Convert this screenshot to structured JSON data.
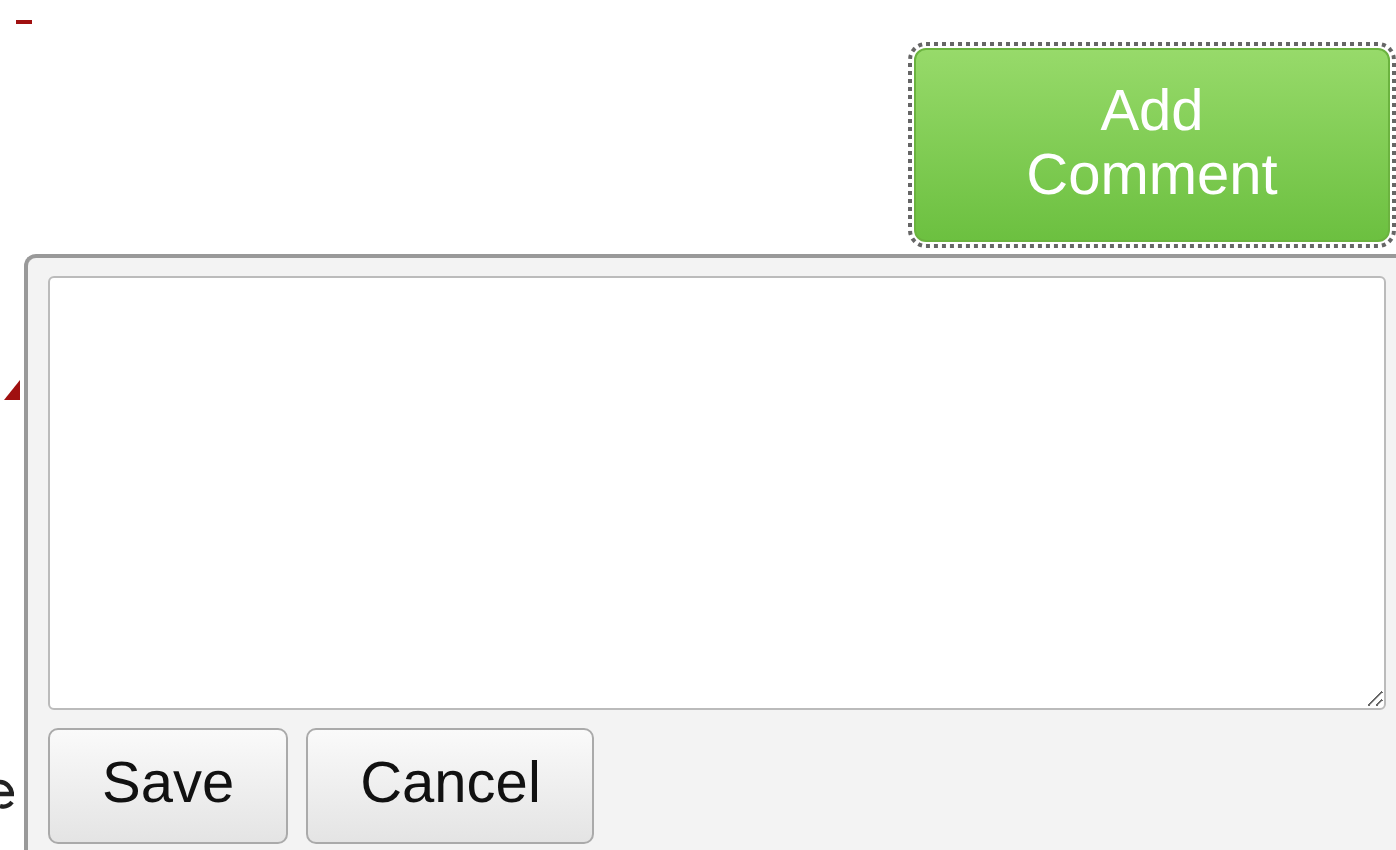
{
  "add_comment_button": {
    "label": "Add Comment",
    "focused": true
  },
  "buttons": [
    {
      "label": "Save"
    },
    {
      "label": "Cancel"
    }
  ]
}
